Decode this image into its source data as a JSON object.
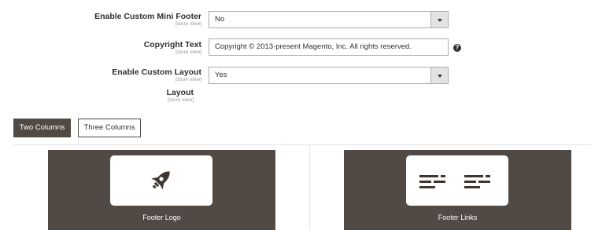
{
  "fields": {
    "mini_footer": {
      "label": "Enable Custom Mini Footer",
      "scope": "[store view]",
      "value": "No"
    },
    "copyright": {
      "label": "Copyright Text",
      "scope": "[store view]",
      "value": "Copyright © 2013-present Magento, Inc. All rights reserved.",
      "help": "?"
    },
    "custom_layout": {
      "label": "Enable Custom Layout",
      "scope": "[store view]",
      "value": "Yes"
    },
    "layout": {
      "label": "Layout",
      "scope": "[store view]"
    }
  },
  "layout_tabs": [
    {
      "label": "Two Columns",
      "active": true
    },
    {
      "label": "Three Columns",
      "active": false
    }
  ],
  "blocks": [
    {
      "caption": "Footer Logo",
      "icon": "rocket-icon"
    },
    {
      "caption": "Footer Links",
      "icon": "links-list-icon"
    }
  ],
  "colors": {
    "block_bg": "#514943",
    "active_tab_bg": "#514943",
    "border": "#adadad"
  }
}
